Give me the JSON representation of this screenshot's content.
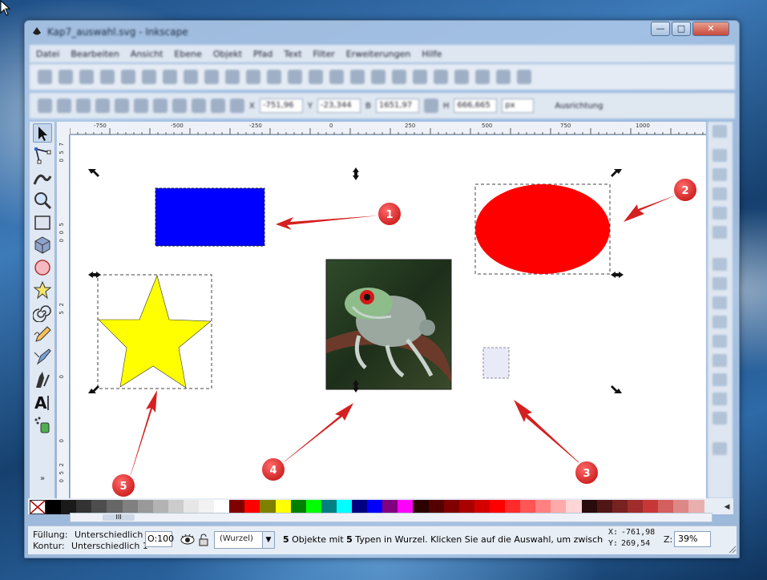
{
  "window": {
    "title": "Kap7_auswahl.svg - Inkscape",
    "buttons": {
      "minimize": "—",
      "maximize": "□",
      "close": "✕"
    }
  },
  "menu": [
    "Datei",
    "Bearbeiten",
    "Ansicht",
    "Ebene",
    "Objekt",
    "Pfad",
    "Text",
    "Filter",
    "Erweiterungen",
    "Hilfe"
  ],
  "toolbar": {
    "x": "-751,96",
    "y": "-23,344",
    "w": "1651,97",
    "h": "666,665",
    "unit": "px",
    "settings": "Ausrichtung"
  },
  "ruler": {
    "top": [
      "-750",
      "-500",
      "-250",
      "0",
      "250",
      "500",
      "750",
      "1000"
    ],
    "left": [
      "7",
      "5",
      "0",
      "5",
      "0",
      "0",
      "2",
      "5",
      "0",
      "0",
      "2",
      "5",
      "0"
    ]
  },
  "canvas": {
    "callouts": [
      "1",
      "2",
      "3",
      "4",
      "5"
    ],
    "objects": {
      "rect": {
        "color": "#0000ff"
      },
      "ellipse": {
        "color": "#ff0000"
      },
      "star": {
        "color": "#ffff00"
      },
      "small_rect": {
        "color": "#e8eaf8"
      }
    }
  },
  "palette": [
    "#000000",
    "#1a1a1a",
    "#333333",
    "#4d4d4d",
    "#666666",
    "#808080",
    "#999999",
    "#b3b3b3",
    "#cccccc",
    "#e6e6e6",
    "#f2f2f2",
    "#ffffff",
    "#800000",
    "#ff0000",
    "#808000",
    "#ffff00",
    "#008000",
    "#00ff00",
    "#008080",
    "#00ffff",
    "#000080",
    "#0000ff",
    "#800080",
    "#ff00ff",
    "#2b0000",
    "#550000",
    "#800000",
    "#aa0000",
    "#d40000",
    "#ff0000",
    "#ff2a2a",
    "#ff5555",
    "#ff8080",
    "#ffaaaa",
    "#ffd5d5",
    "#280b0b",
    "#501616",
    "#782121",
    "#a02c2c",
    "#c83737",
    "#d35f5f",
    "#de8787",
    "#e9afaf"
  ],
  "status": {
    "fill_label": "Füllung:",
    "fill_value": "Unterschiedlich",
    "stroke_label": "Kontur:",
    "stroke_value": "Unterschiedlich 1",
    "opacity_label": "O:",
    "opacity": "100",
    "layer": "(Wurzel)",
    "message_pre": "5",
    "message_mid": " Objekte mit ",
    "message_bold": "5",
    "message_post": " Typen in Wurzel. Klicken Sie auf die Auswahl, um zwischen S...",
    "x_label": "X:",
    "x_value": "-761,98",
    "y_label": "Y:",
    "y_value": "269,54",
    "zoom_label": "Z:",
    "zoom": "39%"
  },
  "scrollbar_thumb": "III",
  "toolbox_more": "»"
}
